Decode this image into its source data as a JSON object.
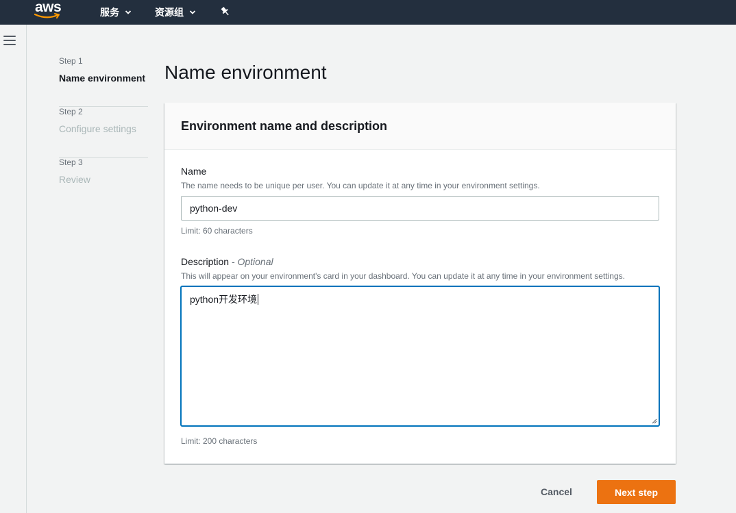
{
  "topnav": {
    "logo_text": "aws",
    "services_label": "服务",
    "resource_groups_label": "资源组",
    "pin_icon": "pin-icon",
    "background": "#232f3e"
  },
  "steps": [
    {
      "number": "Step 1",
      "label": "Name environment",
      "state": "active"
    },
    {
      "number": "Step 2",
      "label": "Configure settings",
      "state": "inactive"
    },
    {
      "number": "Step 3",
      "label": "Review",
      "state": "inactive"
    }
  ],
  "page": {
    "title": "Name environment"
  },
  "panel": {
    "title": "Environment name and description",
    "name_field": {
      "label": "Name",
      "help": "The name needs to be unique per user. You can update it at any time in your environment settings.",
      "value": "python-dev",
      "limit": "Limit: 60 characters"
    },
    "description_field": {
      "label": "Description",
      "optional": " - Optional",
      "help": "This will appear on your environment's card in your dashboard. You can update it at any time in your environment settings.",
      "value": "python开发环境",
      "limit": "Limit: 200 characters"
    }
  },
  "actions": {
    "cancel_label": "Cancel",
    "next_label": "Next step",
    "accent": "#ec7211"
  }
}
